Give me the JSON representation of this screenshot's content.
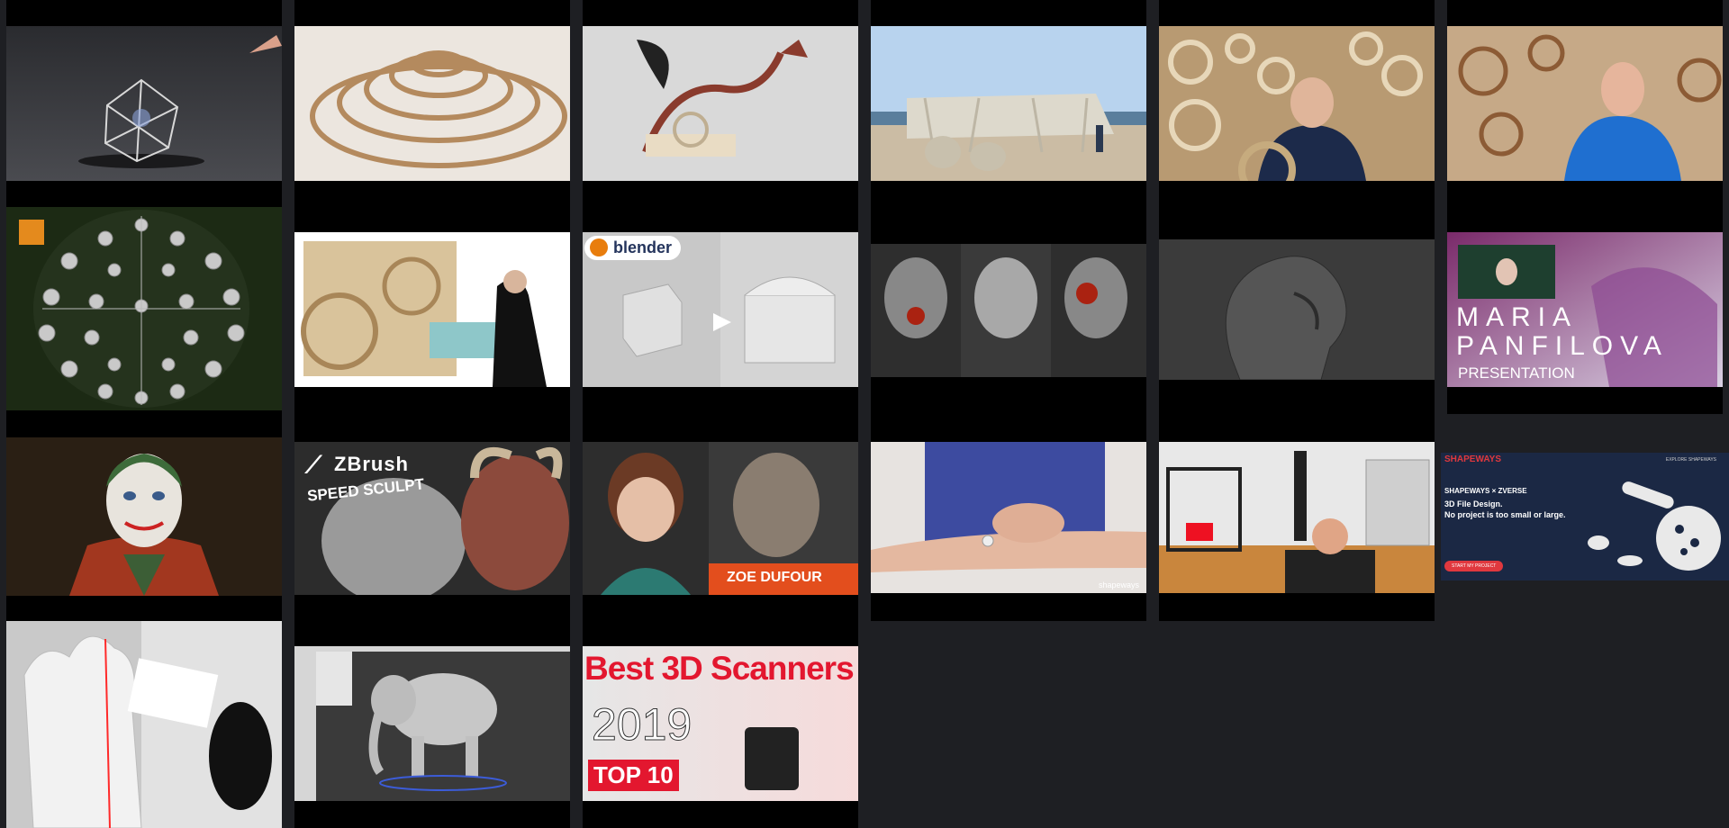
{
  "overlays": {
    "blender_logo": "blender",
    "zbrush_logo": "ZBrush",
    "zbrush_sub": "SPEED SCULPT",
    "maria_line1": "MARIA",
    "maria_line2": "PANFILOVA",
    "maria_line3": "PRESENTATION",
    "zoe": "ZOE DUFOUR",
    "scanners_title": "Best 3D Scanners",
    "scanners_year": "2019",
    "scanners_top": "TOP 10",
    "shapeways_watermark": "shapeways",
    "shapeways_brand": "SHAPEWAYS",
    "shapeways_nav": "EXPLORE SHAPEWAYS",
    "shapeways_partner": "ZVERSE",
    "shapeways_headline1": "3D File Design.",
    "shapeways_headline2": "No project is too small or large.",
    "shapeways_cta": "START MY PROJECT"
  },
  "colors": {
    "page_bg": "#1e1f23",
    "column_bg": "#000000",
    "accent_red": "#e0383e"
  }
}
